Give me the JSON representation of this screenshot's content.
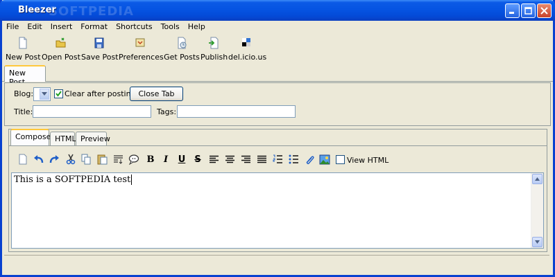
{
  "window": {
    "title": "Bleezer",
    "watermark": "SOFTPEDIA"
  },
  "menu": [
    "File",
    "Edit",
    "Insert",
    "Format",
    "Shortcuts",
    "Tools",
    "Help"
  ],
  "toolbar": {
    "new_post": "New Post",
    "open_post": "Open Post",
    "save_post": "Save Post",
    "preferences": "Preferences",
    "get_posts": "Get Posts",
    "publish": "Publish",
    "delicious": "del.icio.us"
  },
  "doc_tab": "New Post",
  "form": {
    "blog_label": "Blog:",
    "clear_after_posting": "Clear after posting",
    "clear_checked": true,
    "close_tab": "Close Tab",
    "title_label": "Title:",
    "title_value": "",
    "tags_label": "Tags:",
    "tags_value": ""
  },
  "editor_tabs": [
    "Compose",
    "HTML",
    "Preview"
  ],
  "format": {
    "bold": "B",
    "italic": "I",
    "underline": "U",
    "strike": "S",
    "view_html": "View HTML"
  },
  "editor": {
    "content": "This is a SOFTPEDIA test"
  },
  "colors": {
    "titlebar": "#0553e1",
    "accent_tab": "#ffc83c",
    "window_bg": "#ece9d8"
  }
}
